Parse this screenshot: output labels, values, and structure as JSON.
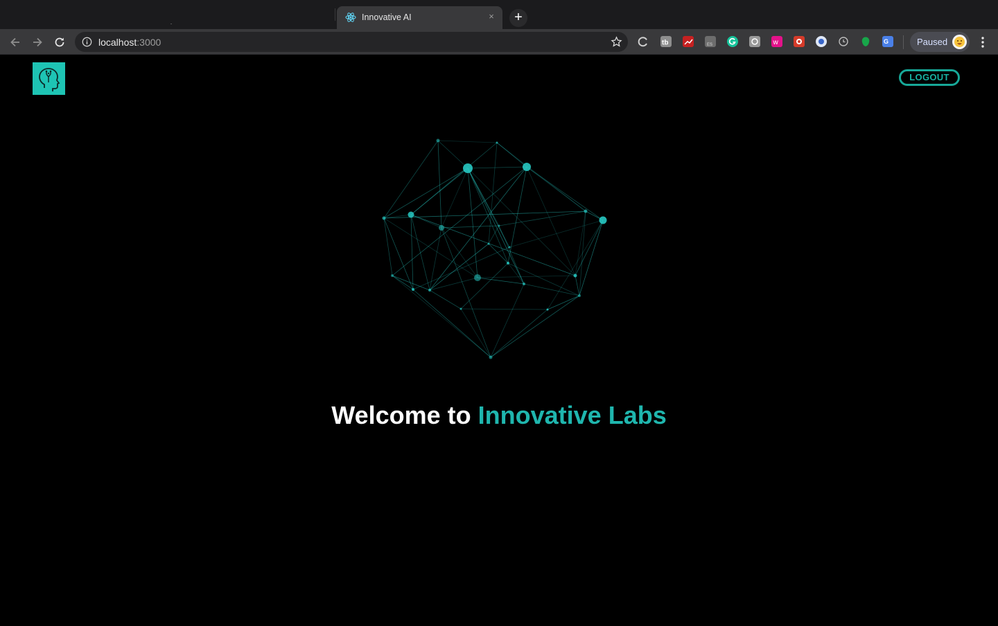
{
  "browser": {
    "tab": {
      "title": "Innovative AI",
      "favicon": "react-atom-icon",
      "close": "×"
    },
    "new_tab": "+",
    "address": {
      "host": "localhost",
      "port": ":3000"
    },
    "profile": {
      "label": "Paused",
      "avatar": "emoji-avatar-icon"
    },
    "extensions": [
      "circle-arrow-icon",
      "tb-icon",
      "red-chart-icon",
      "es-icon",
      "grammarly-icon",
      "box-icon",
      "pink-w-icon",
      "red-plug-icon",
      "blue-circle-icon",
      "clock-icon",
      "green-leaf-icon",
      "translate-icon"
    ]
  },
  "header": {
    "logo_icon": "ai-head-icon",
    "logout_label": "LOGOUT"
  },
  "hero": {
    "graphic": "particle-network",
    "welcome_prefix": "Welcome to ",
    "welcome_brand": "Innovative Labs"
  },
  "colors": {
    "accent": "#1ec4b4",
    "background": "#000000",
    "network": "#27c9c3"
  }
}
